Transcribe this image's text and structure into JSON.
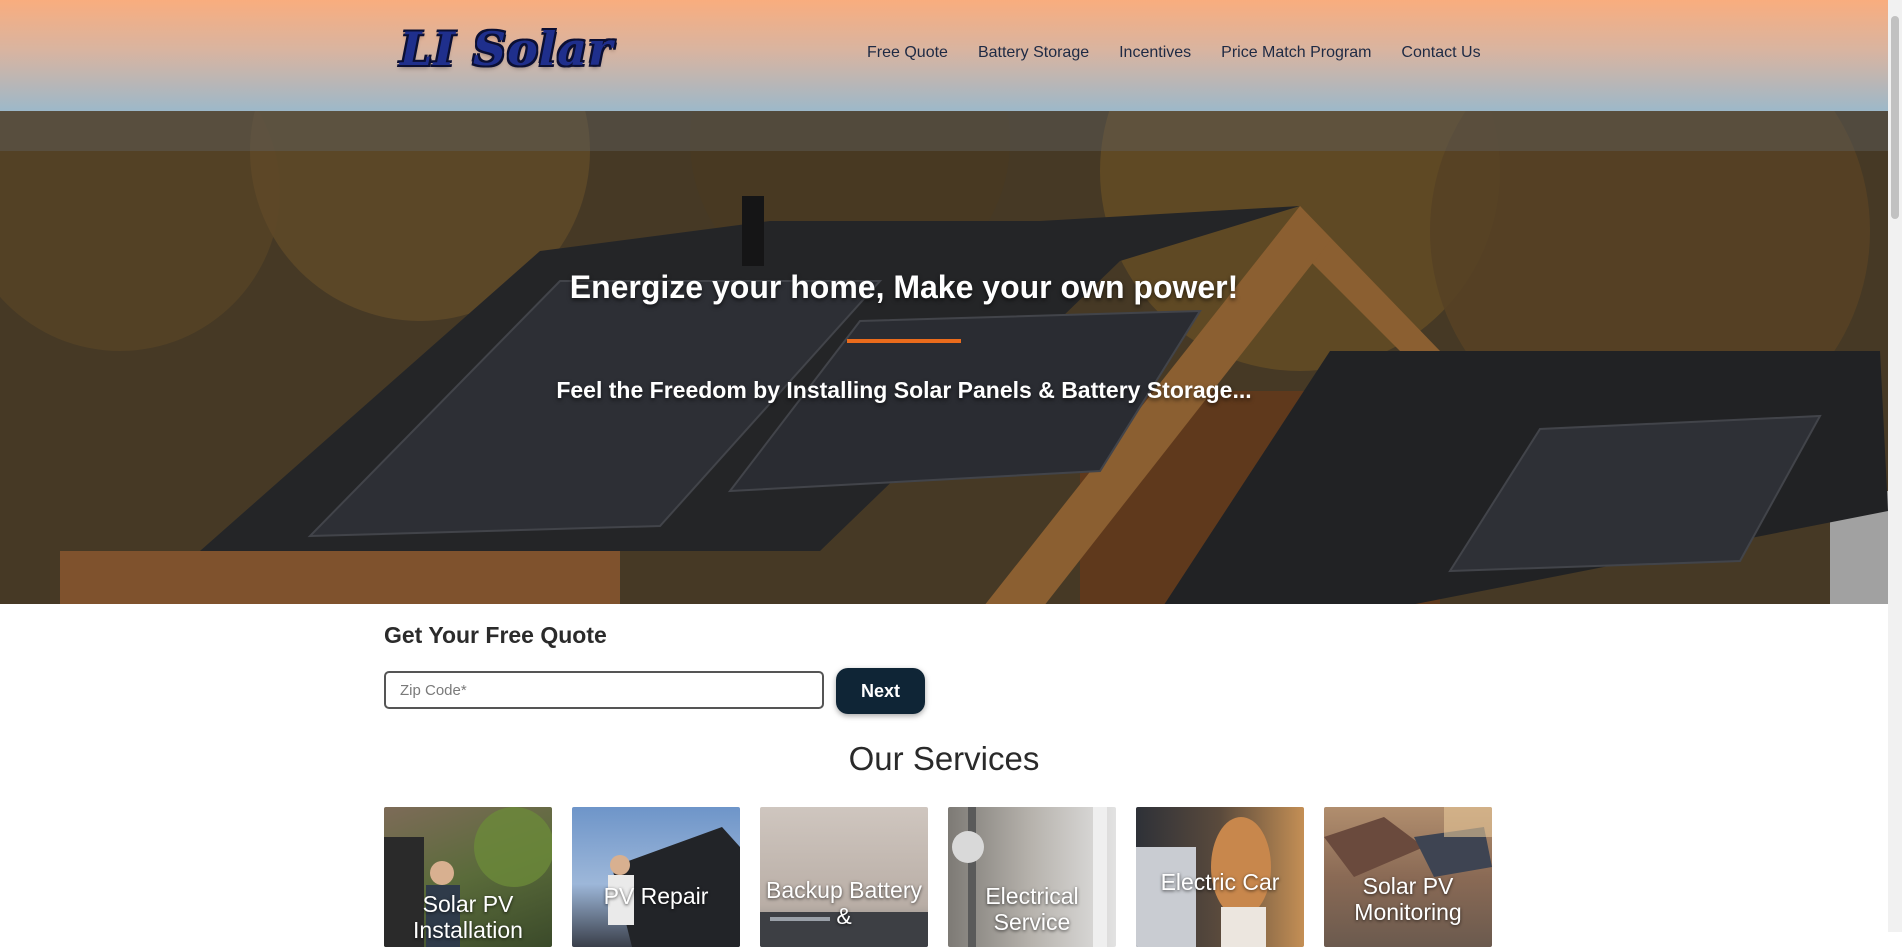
{
  "header": {
    "logo_text": "LI Solar",
    "nav": [
      {
        "label": "Free Quote"
      },
      {
        "label": "Battery Storage"
      },
      {
        "label": "Incentives"
      },
      {
        "label": "Price Match Program"
      },
      {
        "label": "Contact Us"
      }
    ]
  },
  "hero": {
    "title": "Energize your home, Make your own power!",
    "subtitle": "Feel the Freedom by Installing Solar Panels & Battery Storage...",
    "accent_color": "#ea6b1c"
  },
  "quote": {
    "title": "Get Your Free Quote",
    "zip_placeholder": "Zip Code*",
    "next_label": "Next",
    "button_color": "#0f2536"
  },
  "services": {
    "title": "Our Services",
    "cards": [
      {
        "label": "Solar PV Installation"
      },
      {
        "label": "PV Repair"
      },
      {
        "label": "Backup Battery &"
      },
      {
        "label": "Electrical Service"
      },
      {
        "label": "Electric Car"
      },
      {
        "label": "Solar PV Monitoring"
      }
    ]
  }
}
